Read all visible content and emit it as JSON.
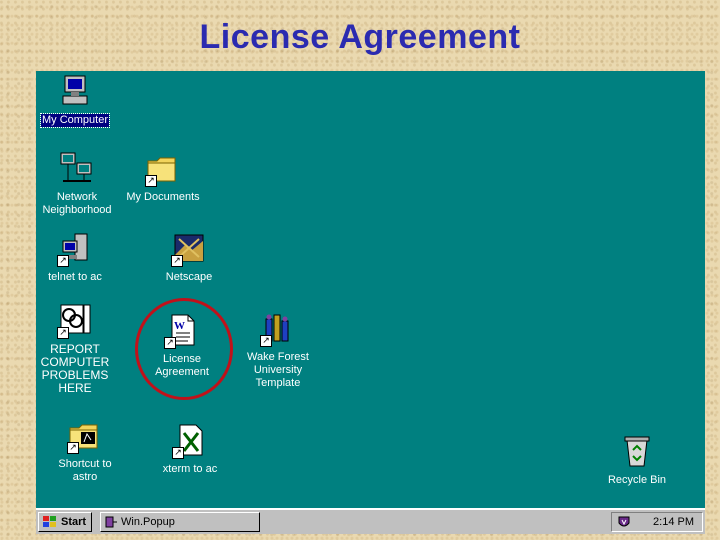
{
  "slide": {
    "title": "License Agreement"
  },
  "desktop": {
    "icons": [
      {
        "label": "My Computer"
      },
      {
        "label": "Network\nNeighborhood"
      },
      {
        "label": "My Documents"
      },
      {
        "label": "telnet to ac"
      },
      {
        "label": "Netscape"
      },
      {
        "label": "REPORT\nCOMPUTER\nPROBLEMS\nHERE"
      },
      {
        "label": "License\nAgreement"
      },
      {
        "label": "Wake Forest\nUniversity\nTemplate"
      },
      {
        "label": "Shortcut to\nastro"
      },
      {
        "label": "xterm to ac"
      },
      {
        "label": "Recycle Bin"
      }
    ]
  },
  "taskbar": {
    "start_label": "Start",
    "task_label": "Win.Popup",
    "clock": "2:14 PM"
  },
  "colors": {
    "desktop": "#008080",
    "title": "#2b2bb0",
    "highlight_circle": "#c0111a"
  }
}
